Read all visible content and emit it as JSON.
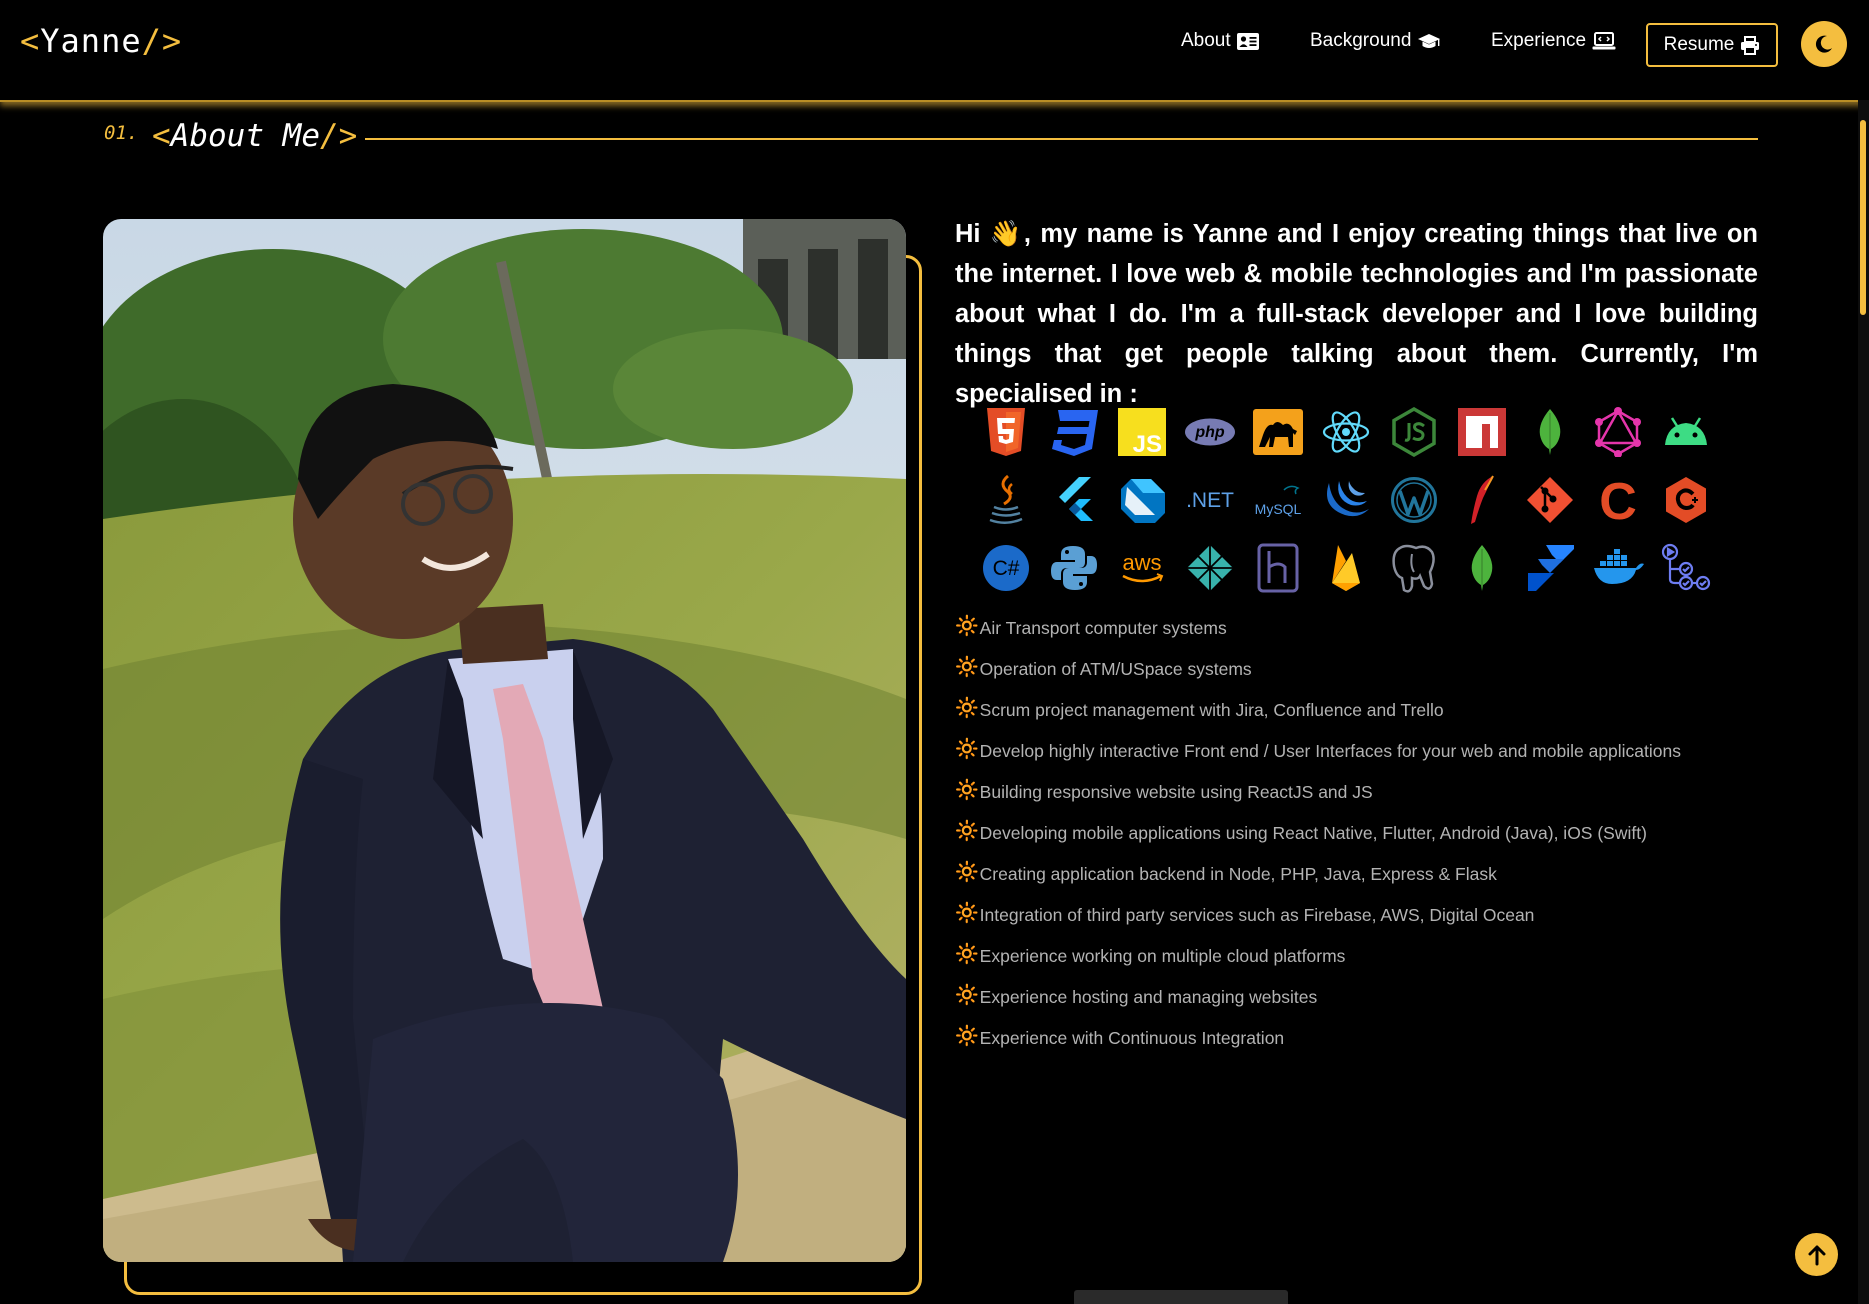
{
  "brand": {
    "open": "<",
    "name": "Yanne",
    "close": "/>"
  },
  "nav": {
    "links": [
      {
        "label": "About",
        "icon": "id-card-icon"
      },
      {
        "label": "Background",
        "icon": "graduation-cap-icon"
      },
      {
        "label": "Experience",
        "icon": "laptop-code-icon"
      }
    ],
    "resume_label": "Resume",
    "resume_icon": "printer-icon",
    "theme_icon": "moon-icon"
  },
  "section": {
    "number": "01.",
    "title_open": "<",
    "title": "About Me",
    "title_close": "/>"
  },
  "photo": {
    "alt": "Portrait photo"
  },
  "intro": "Hi 👋, my name is Yanne and I enjoy creating things that live on the internet. I love web & mobile technologies and I'm passionate about what I do. I'm a full-stack developer and I love building things that get people talking about them. Currently, I'm specialised in :",
  "tech_icons": [
    "html5-icon",
    "css3-icon",
    "javascript-icon",
    "php-icon",
    "perl-icon",
    "react-icon",
    "nodejs-icon",
    "npm-icon",
    "mongodb-icon",
    "graphql-icon",
    "android-icon",
    "java-icon",
    "flutter-icon",
    "dart-icon",
    "dotnet-icon",
    "mysql-icon",
    "jquery-icon",
    "wordpress-icon",
    "apache-icon",
    "git-icon",
    "c-icon",
    "cplusplus-icon",
    "csharp-icon",
    "python-icon",
    "aws-icon",
    "netlify-icon",
    "heroku-icon",
    "firebase-icon",
    "postgresql-icon",
    "mongodb-icon",
    "jira-icon",
    "docker-icon",
    "github-actions-icon"
  ],
  "tech_text": {
    "dotnet": ".NET",
    "mysql": "MySQL",
    "aws": "aws",
    "php": "php",
    "js": "JS",
    "c": "C",
    "csharp": "C#"
  },
  "skills_bullet": "🔆",
  "skills": [
    "Air Transport computer systems",
    "Operation of ATM/USpace systems",
    "Scrum project management with Jira, Confluence and Trello",
    "Develop highly interactive Front end / User Interfaces for your web and mobile applications",
    "Building responsive website using ReactJS and JS",
    "Developing mobile applications using React Native, Flutter, Android (Java), iOS (Swift)",
    "Creating application backend in Node, PHP, Java, Express & Flask",
    "Integration of third party services such as Firebase, AWS, Digital Ocean",
    "Experience working on multiple cloud platforms",
    "Experience hosting and managing websites",
    "Experience with Continuous Integration"
  ],
  "colors": {
    "accent": "#f4be3f",
    "background": "#000000",
    "muted_text": "#b3b3b3"
  }
}
